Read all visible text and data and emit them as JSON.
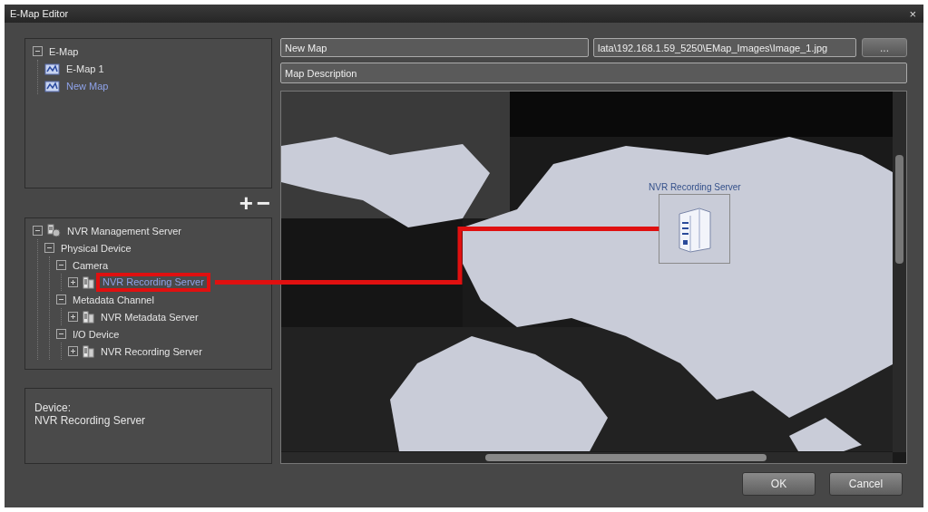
{
  "window": {
    "title": "E-Map Editor",
    "close": "×"
  },
  "map_tree": [
    {
      "label": "E-Map",
      "expanded": true,
      "selected": false,
      "children": [
        {
          "label": "E-Map 1",
          "kind": "map",
          "selected": false
        },
        {
          "label": "New Map",
          "kind": "map",
          "selected": true
        }
      ]
    }
  ],
  "zoom_controls": [
    "+",
    "−"
  ],
  "device_tree": [
    {
      "label": "NVR Management Server",
      "kind": "management",
      "expanded": true,
      "selected": false,
      "children": [
        {
          "label": "Physical Device",
          "expanded": true,
          "selected": false,
          "children": [
            {
              "label": "Camera",
              "expanded": true,
              "selected": false,
              "children": [
                {
                  "label": "NVR Recording Server",
                  "kind": "server",
                  "expanded": false,
                  "selected": true,
                  "callout": true
                }
              ]
            },
            {
              "label": "Metadata Channel",
              "expanded": true,
              "selected": false,
              "children": [
                {
                  "label": "NVR Metadata Server",
                  "kind": "server",
                  "expanded": false,
                  "selected": false
                }
              ]
            },
            {
              "label": "I/O Device",
              "expanded": true,
              "selected": false,
              "children": [
                {
                  "label": "NVR Recording Server",
                  "kind": "server",
                  "expanded": false,
                  "selected": false
                }
              ]
            }
          ]
        }
      ]
    }
  ],
  "device_info": {
    "label": "Device:",
    "value": "NVR Recording Server"
  },
  "map_name": {
    "value": "New Map"
  },
  "image_path": {
    "value": "lata\\192.168.1.59_5250\\EMap_Images\\Image_1.jpg"
  },
  "browse_button": "...",
  "description": {
    "placeholder": "Map Description"
  },
  "map": {
    "markers": [
      {
        "label": "NVR Recording Server",
        "kind": "server"
      }
    ]
  },
  "buttons": [
    "OK",
    "Cancel"
  ]
}
